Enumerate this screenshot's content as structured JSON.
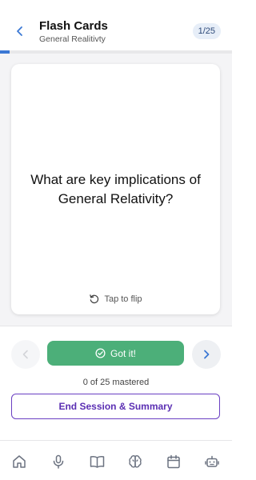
{
  "header": {
    "title": "Flash Cards",
    "subtitle": "General Realitivty",
    "counter": "1/25"
  },
  "progress": {
    "fraction": 0.04
  },
  "card": {
    "question": "What are key implications of General Relativity?",
    "flip_hint": "Tap to flip"
  },
  "controls": {
    "got_it_label": "Got it!",
    "mastered_text": "0 of 25 mastered",
    "end_session_label": "End Session & Summary"
  },
  "bottom_nav": {
    "icons": [
      "home-icon",
      "microphone-icon",
      "book-icon",
      "brain-icon",
      "calendar-icon",
      "robot-icon"
    ]
  },
  "colors": {
    "accent_blue": "#3b78d4",
    "success_green": "#4caf79",
    "purple": "#5b2fb3"
  }
}
